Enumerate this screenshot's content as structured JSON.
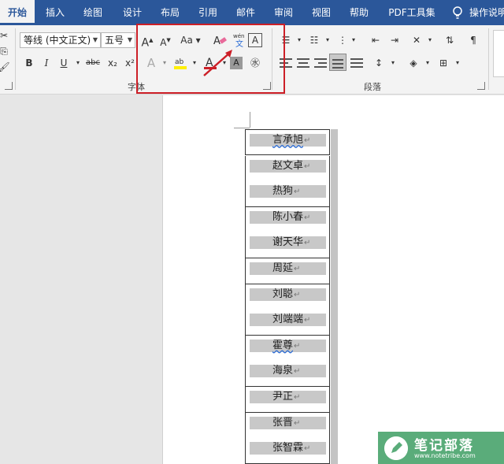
{
  "tabs": [
    {
      "label": "开始",
      "x": 0,
      "w": 44,
      "active": true
    },
    {
      "label": "插入"
    },
    {
      "label": "绘图"
    },
    {
      "label": "设计"
    },
    {
      "label": "布局"
    },
    {
      "label": "引用"
    },
    {
      "label": "邮件"
    },
    {
      "label": "审阅"
    },
    {
      "label": "视图"
    },
    {
      "label": "帮助"
    },
    {
      "label": "PDF工具集"
    }
  ],
  "tell_me": "操作说明",
  "font": {
    "name": "等线 (中文正文)",
    "size": "五号",
    "change_case": "Aa",
    "group_label": "字体"
  },
  "format_buttons": {
    "bold": "B",
    "italic": "I",
    "underline": "U",
    "strike": "abc",
    "subscript": "x₂",
    "superscript": "x²"
  },
  "paragraph": {
    "group_label": "段落"
  },
  "table_rows": [
    {
      "name": "言承旭",
      "underline": true
    },
    {
      "name": "赵文卓"
    },
    {
      "name": "热狗"
    },
    {
      "name": "陈小春"
    },
    {
      "name": "谢天华"
    },
    {
      "name": "周延"
    },
    {
      "name": "刘聪"
    },
    {
      "name": "刘端端"
    },
    {
      "name": "霍尊",
      "underline": true
    },
    {
      "name": "海泉"
    },
    {
      "name": "尹正"
    },
    {
      "name": "张晋"
    },
    {
      "name": "张智霖"
    }
  ],
  "paragraph_mark": "↵",
  "watermark": {
    "title": "笔记部落",
    "url": "www.notetribe.com"
  },
  "colors": {
    "accent": "#2b579a",
    "highlight_box": "#cc1f27",
    "cell_shading": "#c8c8c8",
    "watermark": "#52a873"
  }
}
